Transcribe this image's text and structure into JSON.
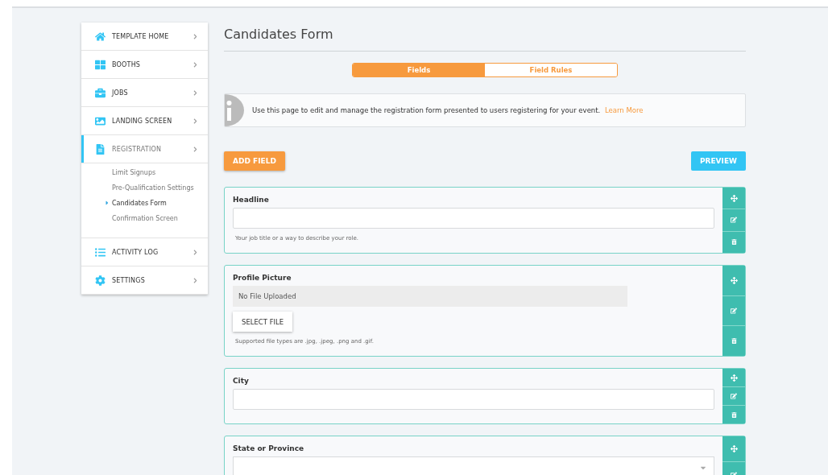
{
  "sidebar": {
    "items": [
      {
        "label": "TEMPLATE HOME",
        "selected": false
      },
      {
        "label": "BOOTHS",
        "selected": false
      },
      {
        "label": "JOBS",
        "selected": false
      },
      {
        "label": "LANDING SCREEN",
        "selected": false
      },
      {
        "label": "REGISTRATION",
        "selected": true,
        "children": [
          {
            "label": "Limit Signups",
            "selected": false
          },
          {
            "label": "Pre-Qualification Settings",
            "selected": false
          },
          {
            "label": "Candidates Form",
            "selected": true
          },
          {
            "label": "Confirmation Screen",
            "selected": false
          }
        ]
      },
      {
        "label": "ACTIVITY LOG",
        "selected": false
      },
      {
        "label": "SETTINGS",
        "selected": false
      }
    ]
  },
  "page": {
    "title": "Candidates Form"
  },
  "tabs": [
    {
      "label": "Fields",
      "selected": true
    },
    {
      "label": "Field Rules",
      "selected": false
    }
  ],
  "info": {
    "text": "Use this page to edit and manage the registration form presented to users registering for your event.",
    "link": "Learn More"
  },
  "actions": {
    "add": "ADD FIELD",
    "preview": "PREVIEW"
  },
  "fields": [
    {
      "kind": "text",
      "label": "Headline",
      "help": "Your job title or a way to describe your role.",
      "actions": [
        {
          "kind": "move"
        },
        {
          "kind": "edit"
        },
        {
          "kind": "delete"
        }
      ]
    },
    {
      "kind": "file",
      "label": "Profile Picture",
      "file_status": "No File Uploaded",
      "button": "SELECT FILE",
      "help": "Supported file types are .jpg, .jpeg, .png and .gif.",
      "actions": [
        {
          "kind": "move"
        },
        {
          "kind": "edit"
        },
        {
          "kind": "delete"
        }
      ]
    },
    {
      "kind": "text",
      "label": "City",
      "actions": [
        {
          "kind": "move"
        },
        {
          "kind": "edit"
        },
        {
          "kind": "delete"
        }
      ]
    },
    {
      "kind": "select",
      "label": "State or Province",
      "actions": [
        {
          "kind": "move"
        },
        {
          "kind": "edit"
        }
      ]
    }
  ]
}
